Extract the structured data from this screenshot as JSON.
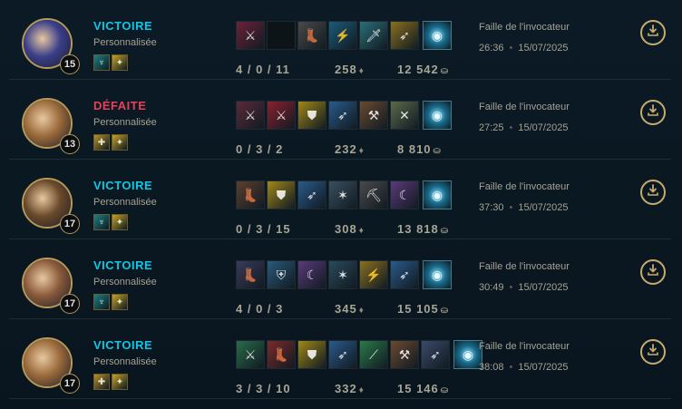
{
  "matches": [
    {
      "result": "VICTOIRE",
      "result_color": "#0ac8e6",
      "mode": "Personnalisée",
      "level": "15",
      "spells": [
        {
          "icon": "ghost-icon",
          "color": "#1d7f86"
        },
        {
          "icon": "flash-icon",
          "color": "#c8a227"
        }
      ],
      "items": [
        {
          "icon": "dagger-icon",
          "color": "#6b2238"
        },
        {
          "icon": "empty-slot",
          "color": "#0d1418"
        },
        {
          "icon": "boots-icon",
          "color": "#4a4a48"
        },
        {
          "icon": "lightning-blade-icon",
          "color": "#1b5b7a"
        },
        {
          "icon": "sword-icon",
          "color": "#2a6f78"
        },
        {
          "icon": "spear-icon",
          "color": "#8a7020"
        },
        {
          "icon": "ward-icon",
          "color": "#1a6a8c"
        }
      ],
      "kda": "4 / 0 / 11",
      "cs": "258",
      "gold": "12 542",
      "map": "Faille de l'invocateur",
      "duration": "26:36",
      "date": "15/07/2025"
    },
    {
      "result": "DÉFAITE",
      "result_color": "#e84057",
      "mode": "Personnalisée",
      "level": "13",
      "spells": [
        {
          "icon": "heal-icon",
          "color": "#b8902a"
        },
        {
          "icon": "flash-icon",
          "color": "#c8a227"
        }
      ],
      "items": [
        {
          "icon": "dagger-icon",
          "color": "#5a2a3a"
        },
        {
          "icon": "cleaver-icon",
          "color": "#8a2030"
        },
        {
          "icon": "shield-icon",
          "color": "#a08818"
        },
        {
          "icon": "spear-icon",
          "color": "#2a5a8a"
        },
        {
          "icon": "hammer-icon",
          "color": "#6a4a30"
        },
        {
          "icon": "axe-icon",
          "color": "#5a6a4a"
        },
        {
          "icon": "ward-icon",
          "color": "#1a6a8c"
        }
      ],
      "kda": "0 / 3 / 2",
      "cs": "232",
      "gold": "8 810",
      "map": "Faille de l'invocateur",
      "duration": "27:25",
      "date": "15/07/2025"
    },
    {
      "result": "VICTOIRE",
      "result_color": "#0ac8e6",
      "mode": "Personnalisée",
      "level": "17",
      "spells": [
        {
          "icon": "ghost-icon",
          "color": "#1d7f86"
        },
        {
          "icon": "flash-icon",
          "color": "#c8a227"
        }
      ],
      "items": [
        {
          "icon": "boots-icon",
          "color": "#5a4030"
        },
        {
          "icon": "shield-icon",
          "color": "#a08818"
        },
        {
          "icon": "spear-icon",
          "color": "#2a5a8a"
        },
        {
          "icon": "claw-icon",
          "color": "#3a5060"
        },
        {
          "icon": "pickaxe-icon",
          "color": "#4a4a4a"
        },
        {
          "icon": "cloak-icon",
          "color": "#5a3a7a"
        },
        {
          "icon": "ward-icon",
          "color": "#1a6a8c"
        }
      ],
      "kda": "0 / 3 / 15",
      "cs": "308",
      "gold": "13 818",
      "map": "Faille de l'invocateur",
      "duration": "37:30",
      "date": "15/07/2025"
    },
    {
      "result": "VICTOIRE",
      "result_color": "#0ac8e6",
      "mode": "Personnalisée",
      "level": "17",
      "spells": [
        {
          "icon": "ghost-icon",
          "color": "#1d7f86"
        },
        {
          "icon": "flash-icon",
          "color": "#c8a227"
        }
      ],
      "items": [
        {
          "icon": "boots-icon",
          "color": "#3a3a5a"
        },
        {
          "icon": "armor-icon",
          "color": "#2a5a7a"
        },
        {
          "icon": "cloak-icon",
          "color": "#5a3a7a"
        },
        {
          "icon": "claw-icon",
          "color": "#2a4a5a"
        },
        {
          "icon": "lightning-blade-icon",
          "color": "#8a7020"
        },
        {
          "icon": "spear-icon",
          "color": "#2a5a8a"
        },
        {
          "icon": "ward-icon",
          "color": "#1a6a8c"
        }
      ],
      "kda": "4 / 0 / 3",
      "cs": "345",
      "gold": "15 105",
      "map": "Faille de l'invocateur",
      "duration": "30:49",
      "date": "15/07/2025"
    },
    {
      "result": "VICTOIRE",
      "result_color": "#0ac8e6",
      "mode": "Personnalisée",
      "level": "17",
      "spells": [
        {
          "icon": "heal-icon",
          "color": "#b8902a"
        },
        {
          "icon": "flash-icon",
          "color": "#c8a227"
        }
      ],
      "items": [
        {
          "icon": "cleaver-icon",
          "color": "#2a6a4a"
        },
        {
          "icon": "boots-icon",
          "color": "#7a2a2a"
        },
        {
          "icon": "shield-icon",
          "color": "#a08818"
        },
        {
          "icon": "spear-icon",
          "color": "#2a5a8a"
        },
        {
          "icon": "blade-icon",
          "color": "#2a7a4a"
        },
        {
          "icon": "hammer-icon",
          "color": "#6a4a30"
        },
        {
          "icon": "spear-icon",
          "color": "#3a4a6a"
        },
        {
          "icon": "ward-icon",
          "color": "#1a6a8c"
        }
      ],
      "kda": "3 / 3 / 10",
      "cs": "332",
      "gold": "15 146",
      "map": "Faille de l'invocateur",
      "duration": "38:08",
      "date": "15/07/2025"
    }
  ],
  "portraits": [
    {
      "icon": "champion-portrait-icon",
      "color": "#3a3f8a"
    },
    {
      "icon": "champion-portrait-icon",
      "color": "#9a6a3a"
    },
    {
      "icon": "champion-portrait-icon",
      "color": "#6a4a2a"
    },
    {
      "icon": "champion-portrait-icon",
      "color": "#8a5a3a"
    },
    {
      "icon": "champion-portrait-icon",
      "color": "#9a6a3a"
    }
  ],
  "colors": {
    "accent_gold": "#c8aa6e",
    "victory": "#0ac8e6",
    "defeat": "#e84057"
  }
}
